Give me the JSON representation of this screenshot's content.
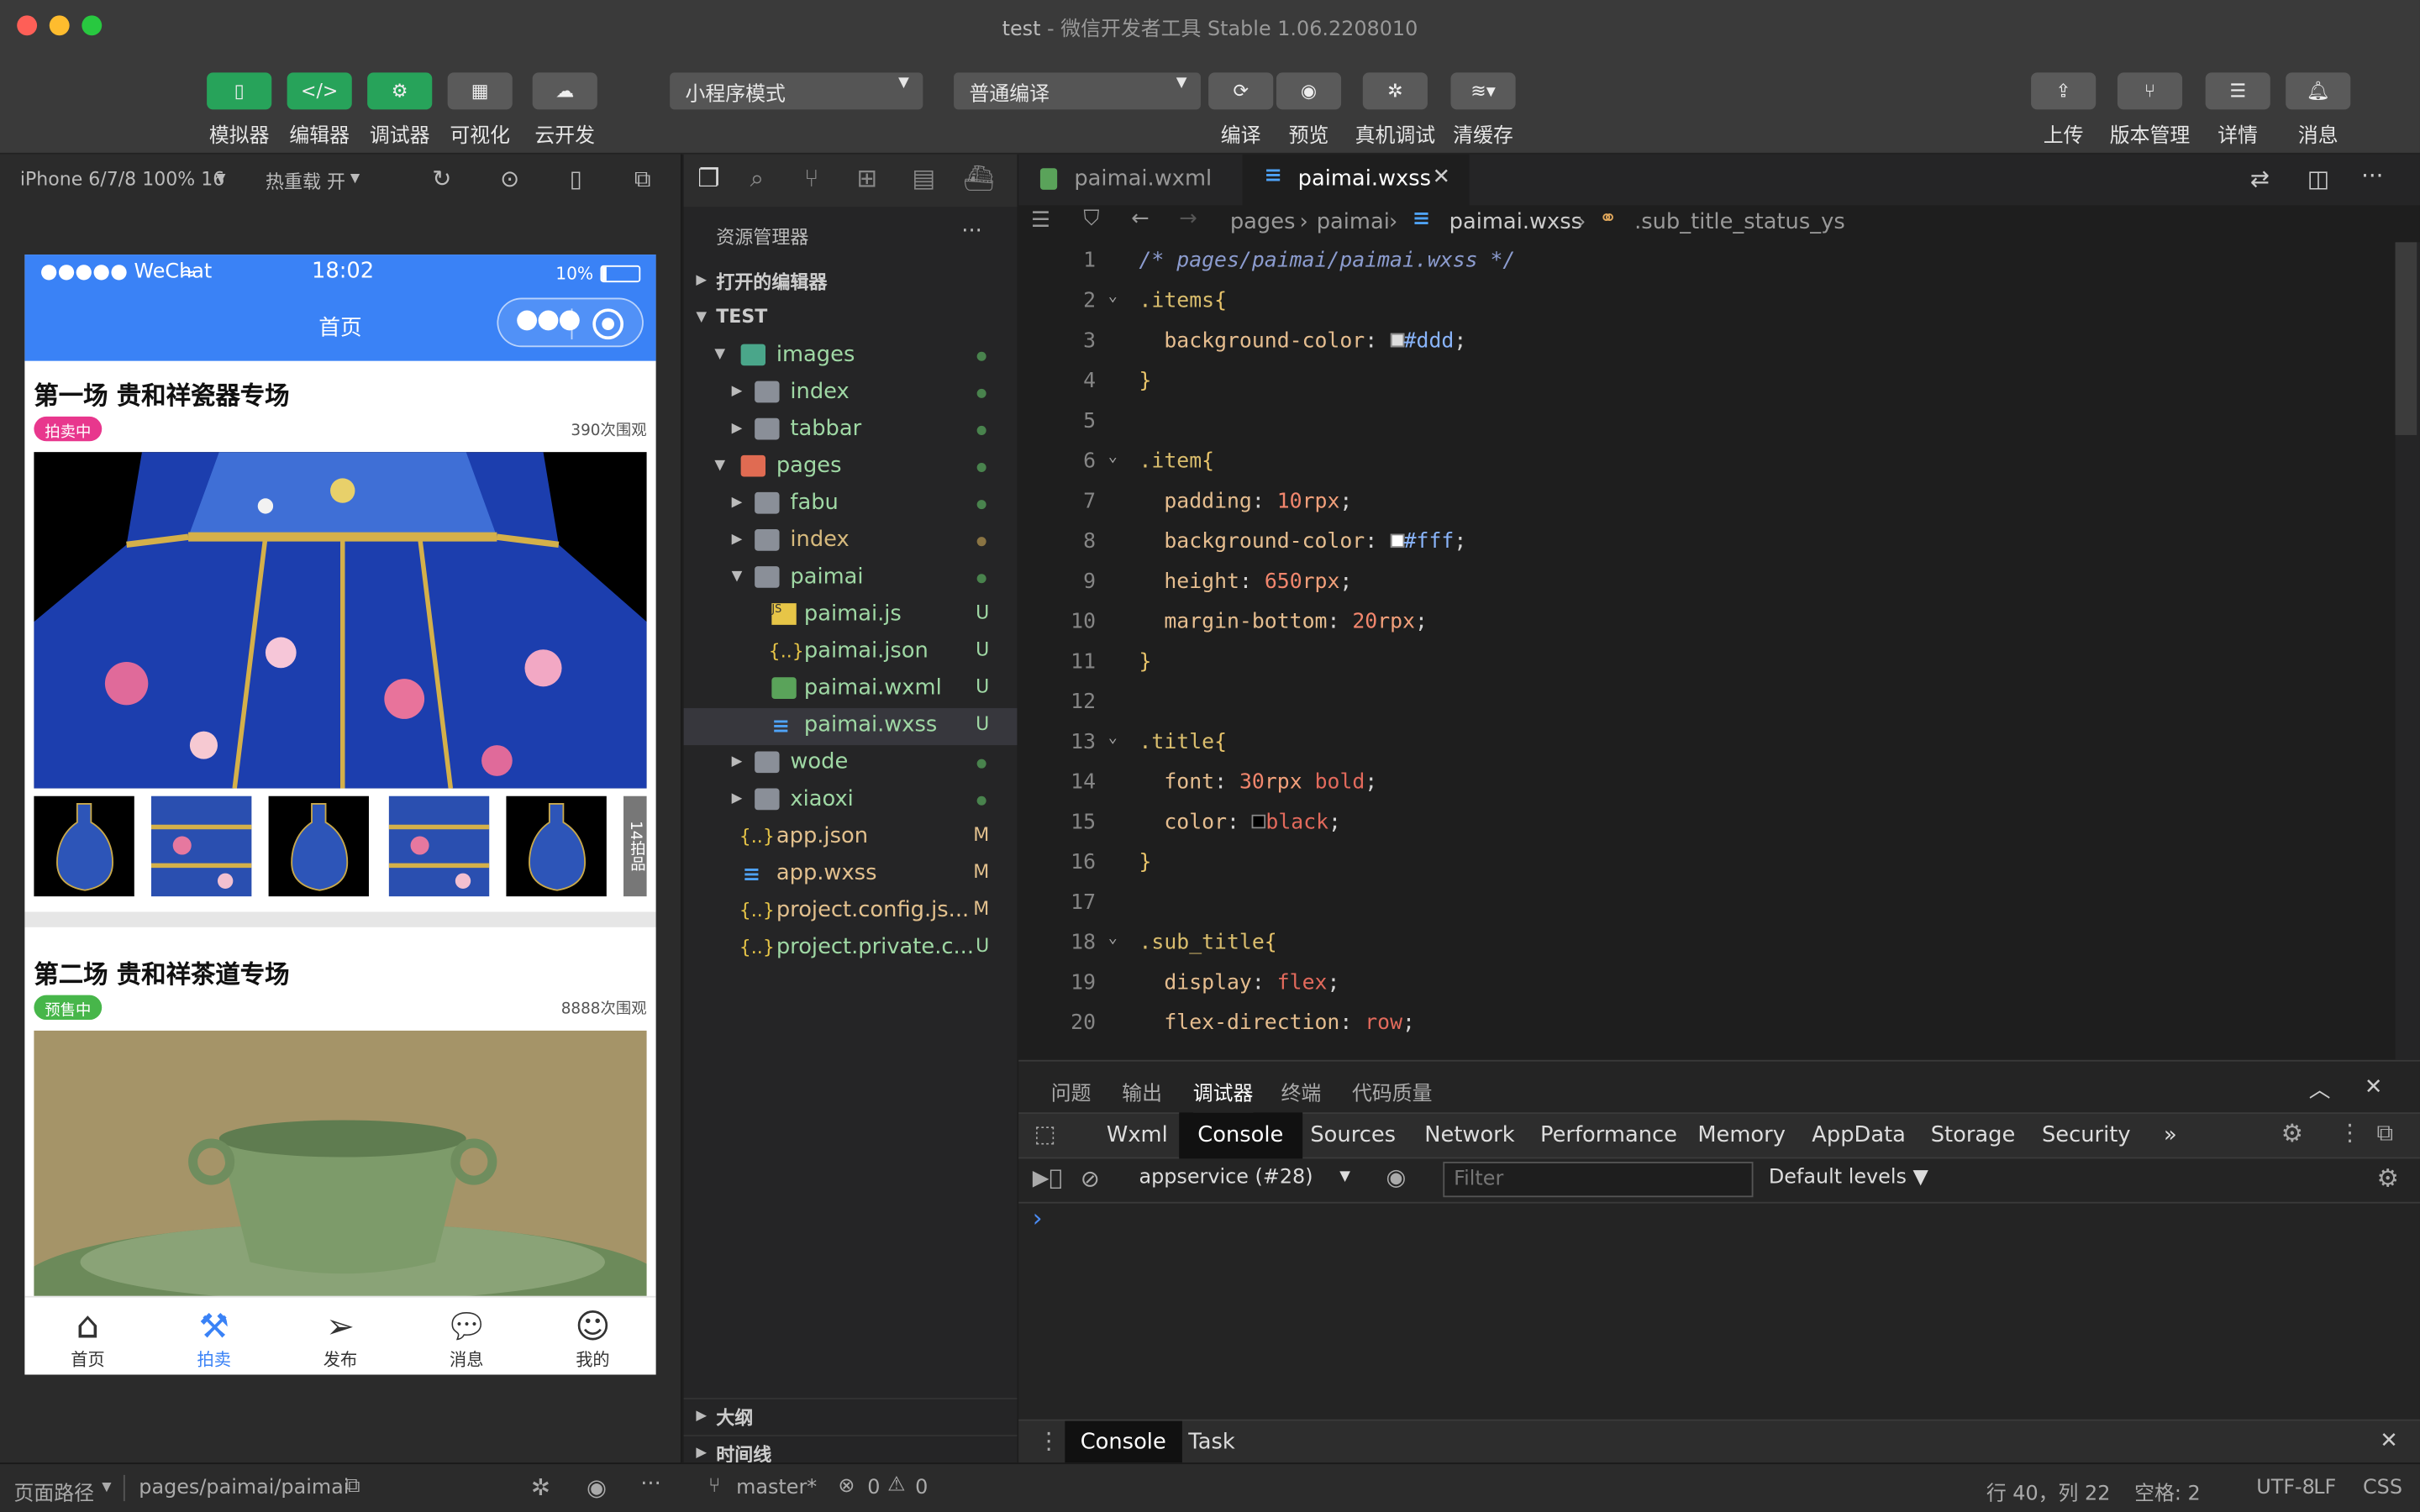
{
  "window": {
    "title": "test",
    "subtitle": "微信开发者工具 Stable 1.06.2208010"
  },
  "toolbar": {
    "left_buttons": [
      "模拟器",
      "编辑器",
      "调试器",
      "可视化",
      "云开发"
    ],
    "mode_select": "小程序模式",
    "compile_select": "普通编译",
    "mid_buttons": [
      "编译",
      "预览",
      "真机调试",
      "清缓存"
    ],
    "right_buttons": [
      "上传",
      "版本管理",
      "详情",
      "消息"
    ]
  },
  "simulator": {
    "device": "iPhone 6/7/8 100% 16",
    "hot_reload": "热重载 开",
    "status_bar": {
      "carrier": "●●●●● WeChat",
      "time": "18:02",
      "battery": "10%"
    },
    "nav_title": "首页",
    "auctions": [
      {
        "title": "第一场 贵和祥瓷器专场",
        "badge": "拍卖中",
        "views": "390次围观",
        "more_label": "14拍品"
      },
      {
        "title": "第二场 贵和祥茶道专场",
        "badge": "预售中",
        "views": "8888次围观"
      }
    ],
    "tabbar": [
      "首页",
      "拍卖",
      "发布",
      "消息",
      "我的"
    ]
  },
  "explorer": {
    "title": "资源管理器",
    "more": "···",
    "open_editors": "打开的编辑器",
    "project": "TEST",
    "tree": [
      {
        "name": "images",
        "status": ""
      },
      {
        "name": "index",
        "status": ""
      },
      {
        "name": "tabbar",
        "status": ""
      },
      {
        "name": "pages",
        "status": ""
      },
      {
        "name": "fabu",
        "status": ""
      },
      {
        "name": "index",
        "status": ""
      },
      {
        "name": "paimai",
        "status": ""
      },
      {
        "name": "paimai.js",
        "status": "U"
      },
      {
        "name": "paimai.json",
        "status": "U"
      },
      {
        "name": "paimai.wxml",
        "status": "U"
      },
      {
        "name": "paimai.wxss",
        "status": "U"
      },
      {
        "name": "wode",
        "status": ""
      },
      {
        "name": "xiaoxi",
        "status": ""
      },
      {
        "name": "app.json",
        "status": "M"
      },
      {
        "name": "app.wxss",
        "status": "M"
      },
      {
        "name": "project.config.js...",
        "status": "M"
      },
      {
        "name": "project.private.c...",
        "status": "U"
      }
    ],
    "outline": "大纲",
    "timeline": "时间线"
  },
  "editor": {
    "tabs": [
      "paimai.wxml",
      "paimai.wxss"
    ],
    "breadcrumbs": [
      "pages",
      "paimai",
      "paimai.wxss",
      ".sub_title_status_ys"
    ],
    "line_numbers": [
      "1",
      "2",
      "3",
      "4",
      "5",
      "6",
      "7",
      "8",
      "9",
      "10",
      "11",
      "12",
      "13",
      "14",
      "15",
      "16",
      "17",
      "18",
      "19",
      "20"
    ]
  },
  "devtools": {
    "top_tabs": [
      "问题",
      "输出",
      "调试器",
      "终端",
      "代码质量"
    ],
    "panel_tabs": [
      "Wxml",
      "Console",
      "Sources",
      "Network",
      "Performance",
      "Memory",
      "AppData",
      "Storage",
      "Security",
      "»"
    ],
    "context": "appservice (#28)",
    "filter_placeholder": "Filter",
    "levels": "Default levels ▼",
    "prompt": "›",
    "drawer_tabs": [
      "Console",
      "Task"
    ]
  },
  "statusbar": {
    "page_path_label": "页面路径",
    "page_path": "pages/paimai/paimai",
    "branch": "master*",
    "errors": "0",
    "warnings": "0",
    "position": "行 40，列 22",
    "spaces": "空格: 2",
    "encoding": "UTF-8",
    "eol": "LF",
    "language": "CSS"
  }
}
